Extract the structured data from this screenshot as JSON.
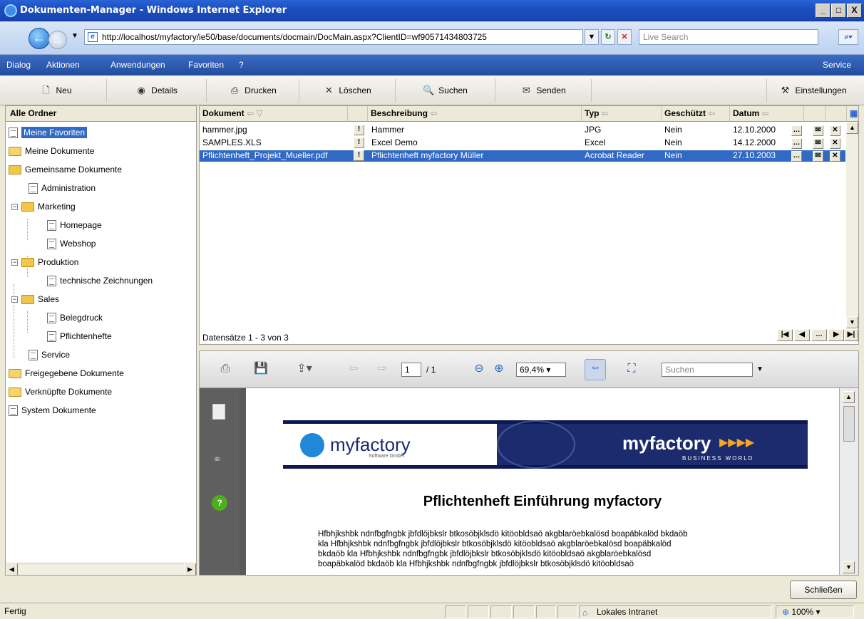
{
  "window": {
    "title": "Dokumenten-Manager - Windows Internet Explorer",
    "buttons": [
      "_",
      "□",
      "X"
    ]
  },
  "browser": {
    "url": "http://localhost/myfactory/ie50/base/documents/docmain/DocMain.aspx?ClientID=wf90571434803725",
    "search_placeholder": "Live Search"
  },
  "menu": {
    "items": [
      "Dialog",
      "Aktionen",
      "Anwendungen",
      "Favoriten",
      "?"
    ],
    "right": "Service"
  },
  "toolbar": {
    "neu": "Neu",
    "details": "Details",
    "drucken": "Drucken",
    "loeschen": "Löschen",
    "suchen": "Suchen",
    "senden": "Senden",
    "einstellungen": "Einstellungen"
  },
  "tree": {
    "header": "Alle Ordner",
    "nodes": [
      "Meine Favoriten",
      "Meine Dokumente",
      "Gemeinsame Dokumente",
      "Administration",
      "Marketing",
      "Homepage",
      "Webshop",
      "Produktion",
      "technische Zeichnungen",
      "Sales",
      "Belegdruck",
      "Pflichtenhefte",
      "Service",
      "Freigegebene Dokumente",
      "Verknüpfte Dokumente",
      "System Dokumente"
    ]
  },
  "grid": {
    "columns": [
      "Dokument",
      "Beschreibung",
      "Typ",
      "Geschützt",
      "Datum"
    ],
    "rows": [
      {
        "dokument": "hammer.jpg",
        "beschreibung": "Hammer",
        "typ": "JPG",
        "geschuetzt": "Nein",
        "datum": "12.10.2000"
      },
      {
        "dokument": "SAMPLES.XLS",
        "beschreibung": "Excel Demo",
        "typ": "Excel",
        "geschuetzt": "Nein",
        "datum": "14.12.2000"
      },
      {
        "dokument": "Pflichtenheft_Projekt_Mueller.pdf",
        "beschreibung": "Pflichtenheft myfactory Müller",
        "typ": "Acrobat Reader",
        "geschuetzt": "Nein",
        "datum": "27.10.2003"
      }
    ],
    "footer": "Datensätze 1 - 3 von 3"
  },
  "pdf": {
    "page_current": "1",
    "page_total": "/ 1",
    "zoom": "69,4%",
    "search_placeholder": "Suchen",
    "logo_left": "myfactory",
    "logo_left_sub": "Software GmbH",
    "logo_right": "myfactory",
    "logo_right_sub": "BUSINESS WORLD",
    "heading": "Pflichtenheft Einführung myfactory",
    "body_lines": [
      "Hfbhjkshbk ndnfbgfngbk jbfdlöjbkslr btkosöbjklsdö kitöobldsaö akgblaröebkalösd boapäbkalöd bkdaöb",
      "kla Hfbhjkshbk ndnfbgfngbk jbfdlöjbkslr btkosöbjklsdö kitöobldsaö akgblaröebkalösd boapäbkalöd",
      "bkdaöb kla Hfbhjkshbk ndnfbgfngbk jbfdlöjbkslr btkosöbjklsdö kitöobldsaö akgblaröebkalösd",
      "boapäbkalöd bkdaöb kla Hfbhjkshbk ndnfbgfngbk jbfdlöjbkslr btkosöbjklsdö kitöobldsaö"
    ]
  },
  "close_label": "Schließen",
  "status": {
    "left": "Fertig",
    "zone": "Lokales Intranet",
    "zoom": "100%"
  },
  "colors": {
    "selection": "#316ac5",
    "menubar": "#234e9e",
    "banner": "#1c2a6e"
  }
}
